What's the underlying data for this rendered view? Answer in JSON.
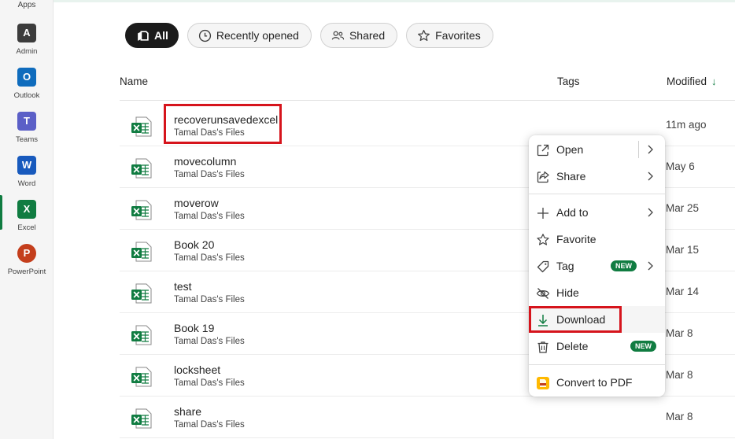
{
  "rail": {
    "top_label": "Apps",
    "apps": [
      {
        "label": "Admin",
        "letter": "A",
        "color": "#3c3c3c",
        "icon": "admin-icon"
      },
      {
        "label": "Outlook",
        "letter": "O",
        "color": "#0f6cbd",
        "icon": "outlook-icon"
      },
      {
        "label": "Teams",
        "letter": "T",
        "color": "#5b5fc7",
        "icon": "teams-icon"
      },
      {
        "label": "Word",
        "letter": "W",
        "color": "#185abd",
        "icon": "word-icon"
      },
      {
        "label": "Excel",
        "letter": "X",
        "color": "#107c41",
        "icon": "excel-icon",
        "active": true
      },
      {
        "label": "PowerPoint",
        "letter": "P",
        "color": "#c43e1c",
        "icon": "powerpoint-icon"
      }
    ]
  },
  "filters": {
    "all": "All",
    "recent": "Recently opened",
    "shared": "Shared",
    "favorites": "Favorites"
  },
  "table": {
    "col_name": "Name",
    "col_tags": "Tags",
    "col_modified": "Modified",
    "sort_icon": "arrow-down-icon",
    "rows": [
      {
        "name": "recoverunsavedexcel",
        "location": "Tamal Das's Files",
        "modified": "11m ago"
      },
      {
        "name": "movecolumn",
        "location": "Tamal Das's Files",
        "modified": "May 6"
      },
      {
        "name": "moverow",
        "location": "Tamal Das's Files",
        "modified": "Mar 25"
      },
      {
        "name": "Book 20",
        "location": "Tamal Das's Files",
        "modified": "Mar 15"
      },
      {
        "name": "test",
        "location": "Tamal Das's Files",
        "modified": "Mar 14"
      },
      {
        "name": "Book 19",
        "location": "Tamal Das's Files",
        "modified": "Mar 8"
      },
      {
        "name": "locksheet",
        "location": "Tamal Das's Files",
        "modified": "Mar 8"
      },
      {
        "name": "share",
        "location": "Tamal Das's Files",
        "modified": "Mar 8"
      }
    ]
  },
  "menu": {
    "open": "Open",
    "share": "Share",
    "add_to": "Add to",
    "favorite": "Favorite",
    "tag": "Tag",
    "tag_badge": "NEW",
    "hide": "Hide",
    "download": "Download",
    "delete": "Delete",
    "delete_badge": "NEW",
    "convert": "Convert to PDF"
  },
  "colors": {
    "accent": "#107c41",
    "highlight": "#d6141c"
  }
}
